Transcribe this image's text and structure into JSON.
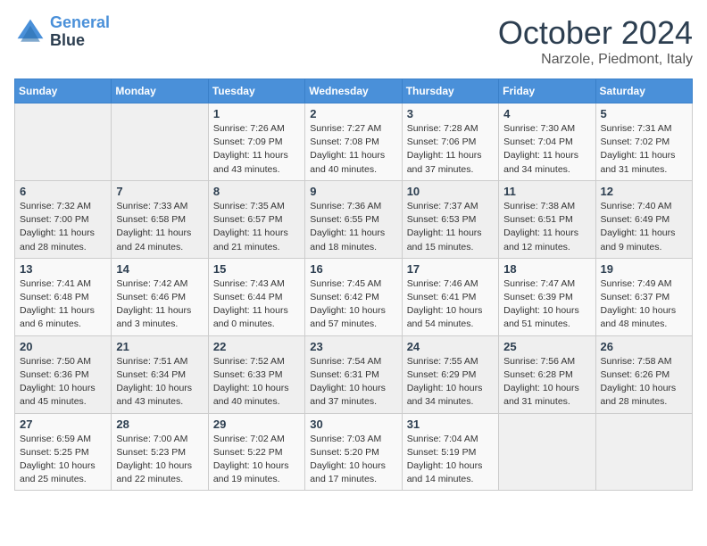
{
  "header": {
    "logo_line1": "General",
    "logo_line2": "Blue",
    "month_year": "October 2024",
    "location": "Narzole, Piedmont, Italy"
  },
  "weekdays": [
    "Sunday",
    "Monday",
    "Tuesday",
    "Wednesday",
    "Thursday",
    "Friday",
    "Saturday"
  ],
  "weeks": [
    [
      {
        "day": "",
        "info": ""
      },
      {
        "day": "",
        "info": ""
      },
      {
        "day": "1",
        "info": "Sunrise: 7:26 AM\nSunset: 7:09 PM\nDaylight: 11 hours and 43 minutes."
      },
      {
        "day": "2",
        "info": "Sunrise: 7:27 AM\nSunset: 7:08 PM\nDaylight: 11 hours and 40 minutes."
      },
      {
        "day": "3",
        "info": "Sunrise: 7:28 AM\nSunset: 7:06 PM\nDaylight: 11 hours and 37 minutes."
      },
      {
        "day": "4",
        "info": "Sunrise: 7:30 AM\nSunset: 7:04 PM\nDaylight: 11 hours and 34 minutes."
      },
      {
        "day": "5",
        "info": "Sunrise: 7:31 AM\nSunset: 7:02 PM\nDaylight: 11 hours and 31 minutes."
      }
    ],
    [
      {
        "day": "6",
        "info": "Sunrise: 7:32 AM\nSunset: 7:00 PM\nDaylight: 11 hours and 28 minutes."
      },
      {
        "day": "7",
        "info": "Sunrise: 7:33 AM\nSunset: 6:58 PM\nDaylight: 11 hours and 24 minutes."
      },
      {
        "day": "8",
        "info": "Sunrise: 7:35 AM\nSunset: 6:57 PM\nDaylight: 11 hours and 21 minutes."
      },
      {
        "day": "9",
        "info": "Sunrise: 7:36 AM\nSunset: 6:55 PM\nDaylight: 11 hours and 18 minutes."
      },
      {
        "day": "10",
        "info": "Sunrise: 7:37 AM\nSunset: 6:53 PM\nDaylight: 11 hours and 15 minutes."
      },
      {
        "day": "11",
        "info": "Sunrise: 7:38 AM\nSunset: 6:51 PM\nDaylight: 11 hours and 12 minutes."
      },
      {
        "day": "12",
        "info": "Sunrise: 7:40 AM\nSunset: 6:49 PM\nDaylight: 11 hours and 9 minutes."
      }
    ],
    [
      {
        "day": "13",
        "info": "Sunrise: 7:41 AM\nSunset: 6:48 PM\nDaylight: 11 hours and 6 minutes."
      },
      {
        "day": "14",
        "info": "Sunrise: 7:42 AM\nSunset: 6:46 PM\nDaylight: 11 hours and 3 minutes."
      },
      {
        "day": "15",
        "info": "Sunrise: 7:43 AM\nSunset: 6:44 PM\nDaylight: 11 hours and 0 minutes."
      },
      {
        "day": "16",
        "info": "Sunrise: 7:45 AM\nSunset: 6:42 PM\nDaylight: 10 hours and 57 minutes."
      },
      {
        "day": "17",
        "info": "Sunrise: 7:46 AM\nSunset: 6:41 PM\nDaylight: 10 hours and 54 minutes."
      },
      {
        "day": "18",
        "info": "Sunrise: 7:47 AM\nSunset: 6:39 PM\nDaylight: 10 hours and 51 minutes."
      },
      {
        "day": "19",
        "info": "Sunrise: 7:49 AM\nSunset: 6:37 PM\nDaylight: 10 hours and 48 minutes."
      }
    ],
    [
      {
        "day": "20",
        "info": "Sunrise: 7:50 AM\nSunset: 6:36 PM\nDaylight: 10 hours and 45 minutes."
      },
      {
        "day": "21",
        "info": "Sunrise: 7:51 AM\nSunset: 6:34 PM\nDaylight: 10 hours and 43 minutes."
      },
      {
        "day": "22",
        "info": "Sunrise: 7:52 AM\nSunset: 6:33 PM\nDaylight: 10 hours and 40 minutes."
      },
      {
        "day": "23",
        "info": "Sunrise: 7:54 AM\nSunset: 6:31 PM\nDaylight: 10 hours and 37 minutes."
      },
      {
        "day": "24",
        "info": "Sunrise: 7:55 AM\nSunset: 6:29 PM\nDaylight: 10 hours and 34 minutes."
      },
      {
        "day": "25",
        "info": "Sunrise: 7:56 AM\nSunset: 6:28 PM\nDaylight: 10 hours and 31 minutes."
      },
      {
        "day": "26",
        "info": "Sunrise: 7:58 AM\nSunset: 6:26 PM\nDaylight: 10 hours and 28 minutes."
      }
    ],
    [
      {
        "day": "27",
        "info": "Sunrise: 6:59 AM\nSunset: 5:25 PM\nDaylight: 10 hours and 25 minutes."
      },
      {
        "day": "28",
        "info": "Sunrise: 7:00 AM\nSunset: 5:23 PM\nDaylight: 10 hours and 22 minutes."
      },
      {
        "day": "29",
        "info": "Sunrise: 7:02 AM\nSunset: 5:22 PM\nDaylight: 10 hours and 19 minutes."
      },
      {
        "day": "30",
        "info": "Sunrise: 7:03 AM\nSunset: 5:20 PM\nDaylight: 10 hours and 17 minutes."
      },
      {
        "day": "31",
        "info": "Sunrise: 7:04 AM\nSunset: 5:19 PM\nDaylight: 10 hours and 14 minutes."
      },
      {
        "day": "",
        "info": ""
      },
      {
        "day": "",
        "info": ""
      }
    ]
  ]
}
